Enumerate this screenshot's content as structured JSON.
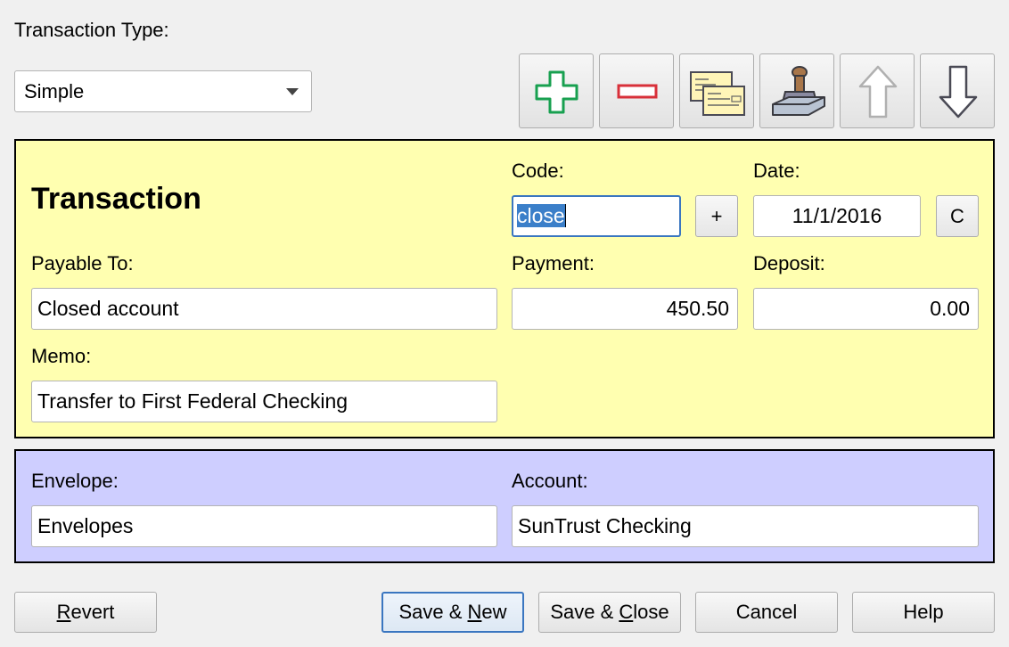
{
  "transaction_type": {
    "label": "Transaction Type:",
    "selected": "Simple"
  },
  "toolbar": {
    "icons": [
      "add-icon",
      "remove-icon",
      "checks-icon",
      "stamp-icon",
      "move-up-icon",
      "move-down-icon"
    ],
    "move_up_disabled": true
  },
  "transaction": {
    "heading": "Transaction",
    "code": {
      "label": "Code:",
      "value": "close",
      "button": "+"
    },
    "date": {
      "label": "Date:",
      "value": "11/1/2016",
      "button": "C"
    },
    "payable_to": {
      "label": "Payable To:",
      "value": "Closed account"
    },
    "payment": {
      "label": "Payment:",
      "value": "450.50"
    },
    "deposit": {
      "label": "Deposit:",
      "value": "0.00"
    },
    "memo": {
      "label": "Memo:",
      "value": "Transfer to First Federal Checking"
    },
    "background": "#ffffb0"
  },
  "allocation": {
    "envelope": {
      "label": "Envelope:",
      "value": "Envelopes"
    },
    "account": {
      "label": "Account:",
      "value": "SunTrust Checking"
    },
    "background": "#ceceff"
  },
  "buttons": {
    "revert": {
      "pre": "",
      "key": "R",
      "post": "evert"
    },
    "save_new": {
      "pre": "Save & ",
      "key": "N",
      "post": "ew"
    },
    "save_close": {
      "pre": "Save & ",
      "key": "C",
      "post": "lose"
    },
    "cancel": "Cancel",
    "help": "Help"
  },
  "colors": {
    "focus_border": "#3a76c0",
    "selection": "#3b7fc9"
  }
}
